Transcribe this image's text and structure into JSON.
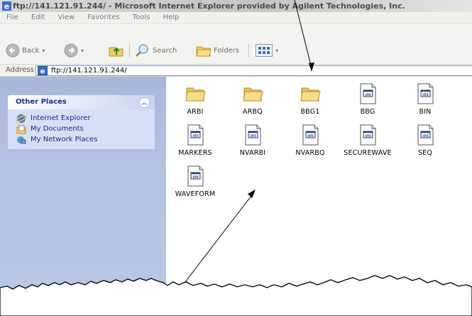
{
  "window": {
    "title": "ftp://141.121.91.244/ - Microsoft Internet Explorer provided by Agilent Technologies, Inc."
  },
  "menu": [
    "File",
    "Edit",
    "View",
    "Favorites",
    "Tools",
    "Help"
  ],
  "toolbar": {
    "back_label": "Back",
    "search_label": "Search",
    "folders_label": "Folders"
  },
  "address": {
    "label": "Address",
    "value": "ftp://141.121.91.244/"
  },
  "sidebar": {
    "panel_title": "Other Places",
    "items": [
      {
        "label": "Internet Explorer",
        "icon": "internet-explorer-icon"
      },
      {
        "label": "My Documents",
        "icon": "my-documents-icon"
      },
      {
        "label": "My Network Places",
        "icon": "network-places-icon"
      }
    ]
  },
  "files": [
    {
      "name": "ARBI",
      "type": "folder"
    },
    {
      "name": "ARBQ",
      "type": "folder"
    },
    {
      "name": "BBG1",
      "type": "folder"
    },
    {
      "name": "BBG",
      "type": "file"
    },
    {
      "name": "BIN",
      "type": "file"
    },
    {
      "name": "MARKERS",
      "type": "file"
    },
    {
      "name": "NVARBI",
      "type": "file"
    },
    {
      "name": "NVARBQ",
      "type": "file"
    },
    {
      "name": "SECUREWAVE",
      "type": "file"
    },
    {
      "name": "SEQ",
      "type": "file"
    },
    {
      "name": "WAVEFORM",
      "type": "file"
    }
  ],
  "colors": {
    "sidebar_bg": "#b5c2e4",
    "folder_yellow": "#f3d26a",
    "panel_title": "#20308a"
  }
}
